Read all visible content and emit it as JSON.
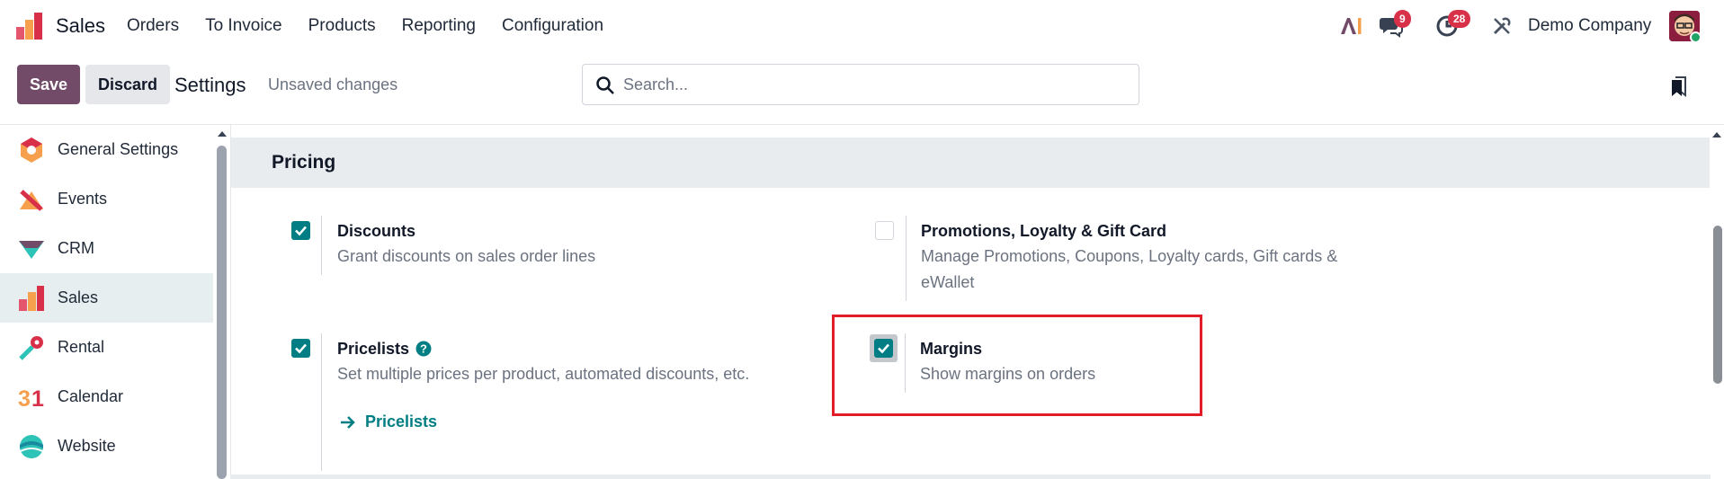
{
  "navbar": {
    "app_name": "Sales",
    "menu": [
      "Orders",
      "To Invoice",
      "Products",
      "Reporting",
      "Configuration"
    ],
    "messages_count": "9",
    "activities_count": "28",
    "company": "Demo Company"
  },
  "control_panel": {
    "save_label": "Save",
    "discard_label": "Discard",
    "title": "Settings",
    "status": "Unsaved changes",
    "search_placeholder": "Search..."
  },
  "sidebar": {
    "items": [
      {
        "label": "General Settings",
        "icon": "general-settings-icon"
      },
      {
        "label": "Events",
        "icon": "events-icon"
      },
      {
        "label": "CRM",
        "icon": "crm-icon"
      },
      {
        "label": "Sales",
        "icon": "sales-icon",
        "active": true
      },
      {
        "label": "Rental",
        "icon": "rental-icon"
      },
      {
        "label": "Calendar",
        "icon": "calendar-icon"
      },
      {
        "label": "Website",
        "icon": "website-icon"
      }
    ]
  },
  "section": {
    "title": "Pricing",
    "settings": {
      "discounts": {
        "title": "Discounts",
        "description": "Grant discounts on sales order lines",
        "checked": true
      },
      "promotions": {
        "title": "Promotions, Loyalty & Gift Card",
        "description_line1": "Manage Promotions, Coupons, Loyalty cards, Gift cards &",
        "description_line2": "eWallet",
        "checked": false
      },
      "pricelists": {
        "title": "Pricelists",
        "description": "Set multiple prices per product, automated discounts, etc.",
        "link_label": "Pricelists",
        "checked": true
      },
      "margins": {
        "title": "Margins",
        "description": "Show margins on orders",
        "checked": true
      }
    }
  },
  "colors": {
    "brand": "#714b67",
    "checkbox": "#017e84",
    "highlight": "#e11d2a",
    "badge": "#d9304a"
  }
}
